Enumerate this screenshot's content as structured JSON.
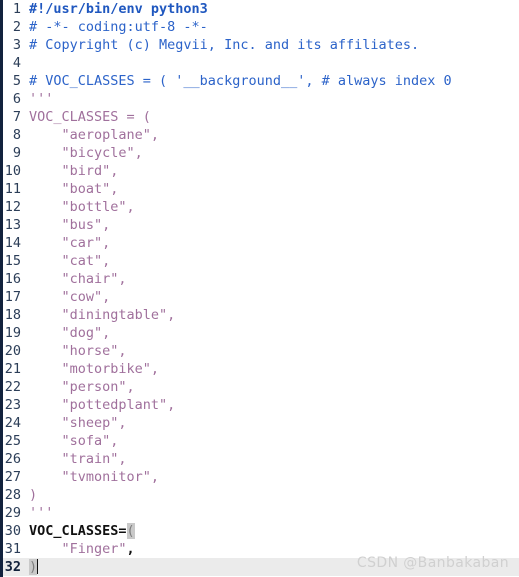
{
  "editor": {
    "language": "python",
    "theme": "light",
    "total_lines": 32,
    "current_line": 32,
    "colors": {
      "background": "#ffffff",
      "comment": "#2c63c9",
      "string": "#a0709c",
      "docstring": "#a0709c",
      "plain_text": "#101010",
      "line_number": "#2c3e58",
      "current_line_background": "#ebebeb",
      "bracket_match_background": "#c9c9c9",
      "left_edge_strip": "#12223d"
    }
  },
  "lines": [
    {
      "num": "1",
      "segments": [
        {
          "text": "#!/usr/bin/env python3",
          "type": "shebang"
        }
      ]
    },
    {
      "num": "2",
      "segments": [
        {
          "text": "# -*- coding:utf-8 -*-",
          "type": "comment"
        }
      ]
    },
    {
      "num": "3",
      "segments": [
        {
          "text": "# Copyright (c) Megvii, Inc. and its affiliates.",
          "type": "comment"
        }
      ]
    },
    {
      "num": "4",
      "segments": [
        {
          "text": "",
          "type": "plain"
        }
      ]
    },
    {
      "num": "5",
      "segments": [
        {
          "text": "# VOC_CLASSES = ( '__background__', # always index 0",
          "type": "comment"
        }
      ]
    },
    {
      "num": "6",
      "segments": [
        {
          "text": "'''",
          "type": "doc"
        }
      ]
    },
    {
      "num": "7",
      "segments": [
        {
          "text": "VOC_CLASSES = (",
          "type": "doc"
        }
      ]
    },
    {
      "num": "8",
      "segments": [
        {
          "text": "    \"aeroplane\",",
          "type": "doc"
        }
      ]
    },
    {
      "num": "9",
      "segments": [
        {
          "text": "    \"bicycle\",",
          "type": "doc"
        }
      ]
    },
    {
      "num": "10",
      "segments": [
        {
          "text": "    \"bird\",",
          "type": "doc"
        }
      ]
    },
    {
      "num": "11",
      "segments": [
        {
          "text": "    \"boat\",",
          "type": "doc"
        }
      ]
    },
    {
      "num": "12",
      "segments": [
        {
          "text": "    \"bottle\",",
          "type": "doc"
        }
      ]
    },
    {
      "num": "13",
      "segments": [
        {
          "text": "    \"bus\",",
          "type": "doc"
        }
      ]
    },
    {
      "num": "14",
      "segments": [
        {
          "text": "    \"car\",",
          "type": "doc"
        }
      ]
    },
    {
      "num": "15",
      "segments": [
        {
          "text": "    \"cat\",",
          "type": "doc"
        }
      ]
    },
    {
      "num": "16",
      "segments": [
        {
          "text": "    \"chair\",",
          "type": "doc"
        }
      ]
    },
    {
      "num": "17",
      "segments": [
        {
          "text": "    \"cow\",",
          "type": "doc"
        }
      ]
    },
    {
      "num": "18",
      "segments": [
        {
          "text": "    \"diningtable\",",
          "type": "doc"
        }
      ]
    },
    {
      "num": "19",
      "segments": [
        {
          "text": "    \"dog\",",
          "type": "doc"
        }
      ]
    },
    {
      "num": "20",
      "segments": [
        {
          "text": "    \"horse\",",
          "type": "doc"
        }
      ]
    },
    {
      "num": "21",
      "segments": [
        {
          "text": "    \"motorbike\",",
          "type": "doc"
        }
      ]
    },
    {
      "num": "22",
      "segments": [
        {
          "text": "    \"person\",",
          "type": "doc"
        }
      ]
    },
    {
      "num": "23",
      "segments": [
        {
          "text": "    \"pottedplant\",",
          "type": "doc"
        }
      ]
    },
    {
      "num": "24",
      "segments": [
        {
          "text": "    \"sheep\",",
          "type": "doc"
        }
      ]
    },
    {
      "num": "25",
      "segments": [
        {
          "text": "    \"sofa\",",
          "type": "doc"
        }
      ]
    },
    {
      "num": "26",
      "segments": [
        {
          "text": "    \"train\",",
          "type": "doc"
        }
      ]
    },
    {
      "num": "27",
      "segments": [
        {
          "text": "    \"tvmonitor\",",
          "type": "doc"
        }
      ]
    },
    {
      "num": "28",
      "segments": [
        {
          "text": ")",
          "type": "doc"
        }
      ]
    },
    {
      "num": "29",
      "segments": [
        {
          "text": "'''",
          "type": "doc"
        }
      ]
    },
    {
      "num": "30",
      "segments": [
        {
          "text": "VOC_CLASSES=",
          "type": "plain"
        },
        {
          "text": "(",
          "type": "bracket-match"
        }
      ]
    },
    {
      "num": "31",
      "segments": [
        {
          "text": "    ",
          "type": "plain"
        },
        {
          "text": "\"Finger\"",
          "type": "str"
        },
        {
          "text": ",",
          "type": "punct"
        }
      ]
    },
    {
      "num": "32",
      "current": true,
      "caret": true,
      "segments": [
        {
          "text": ")",
          "type": "bracket-match"
        }
      ]
    }
  ],
  "watermark": {
    "text": "CSDN @Banbakaban"
  }
}
